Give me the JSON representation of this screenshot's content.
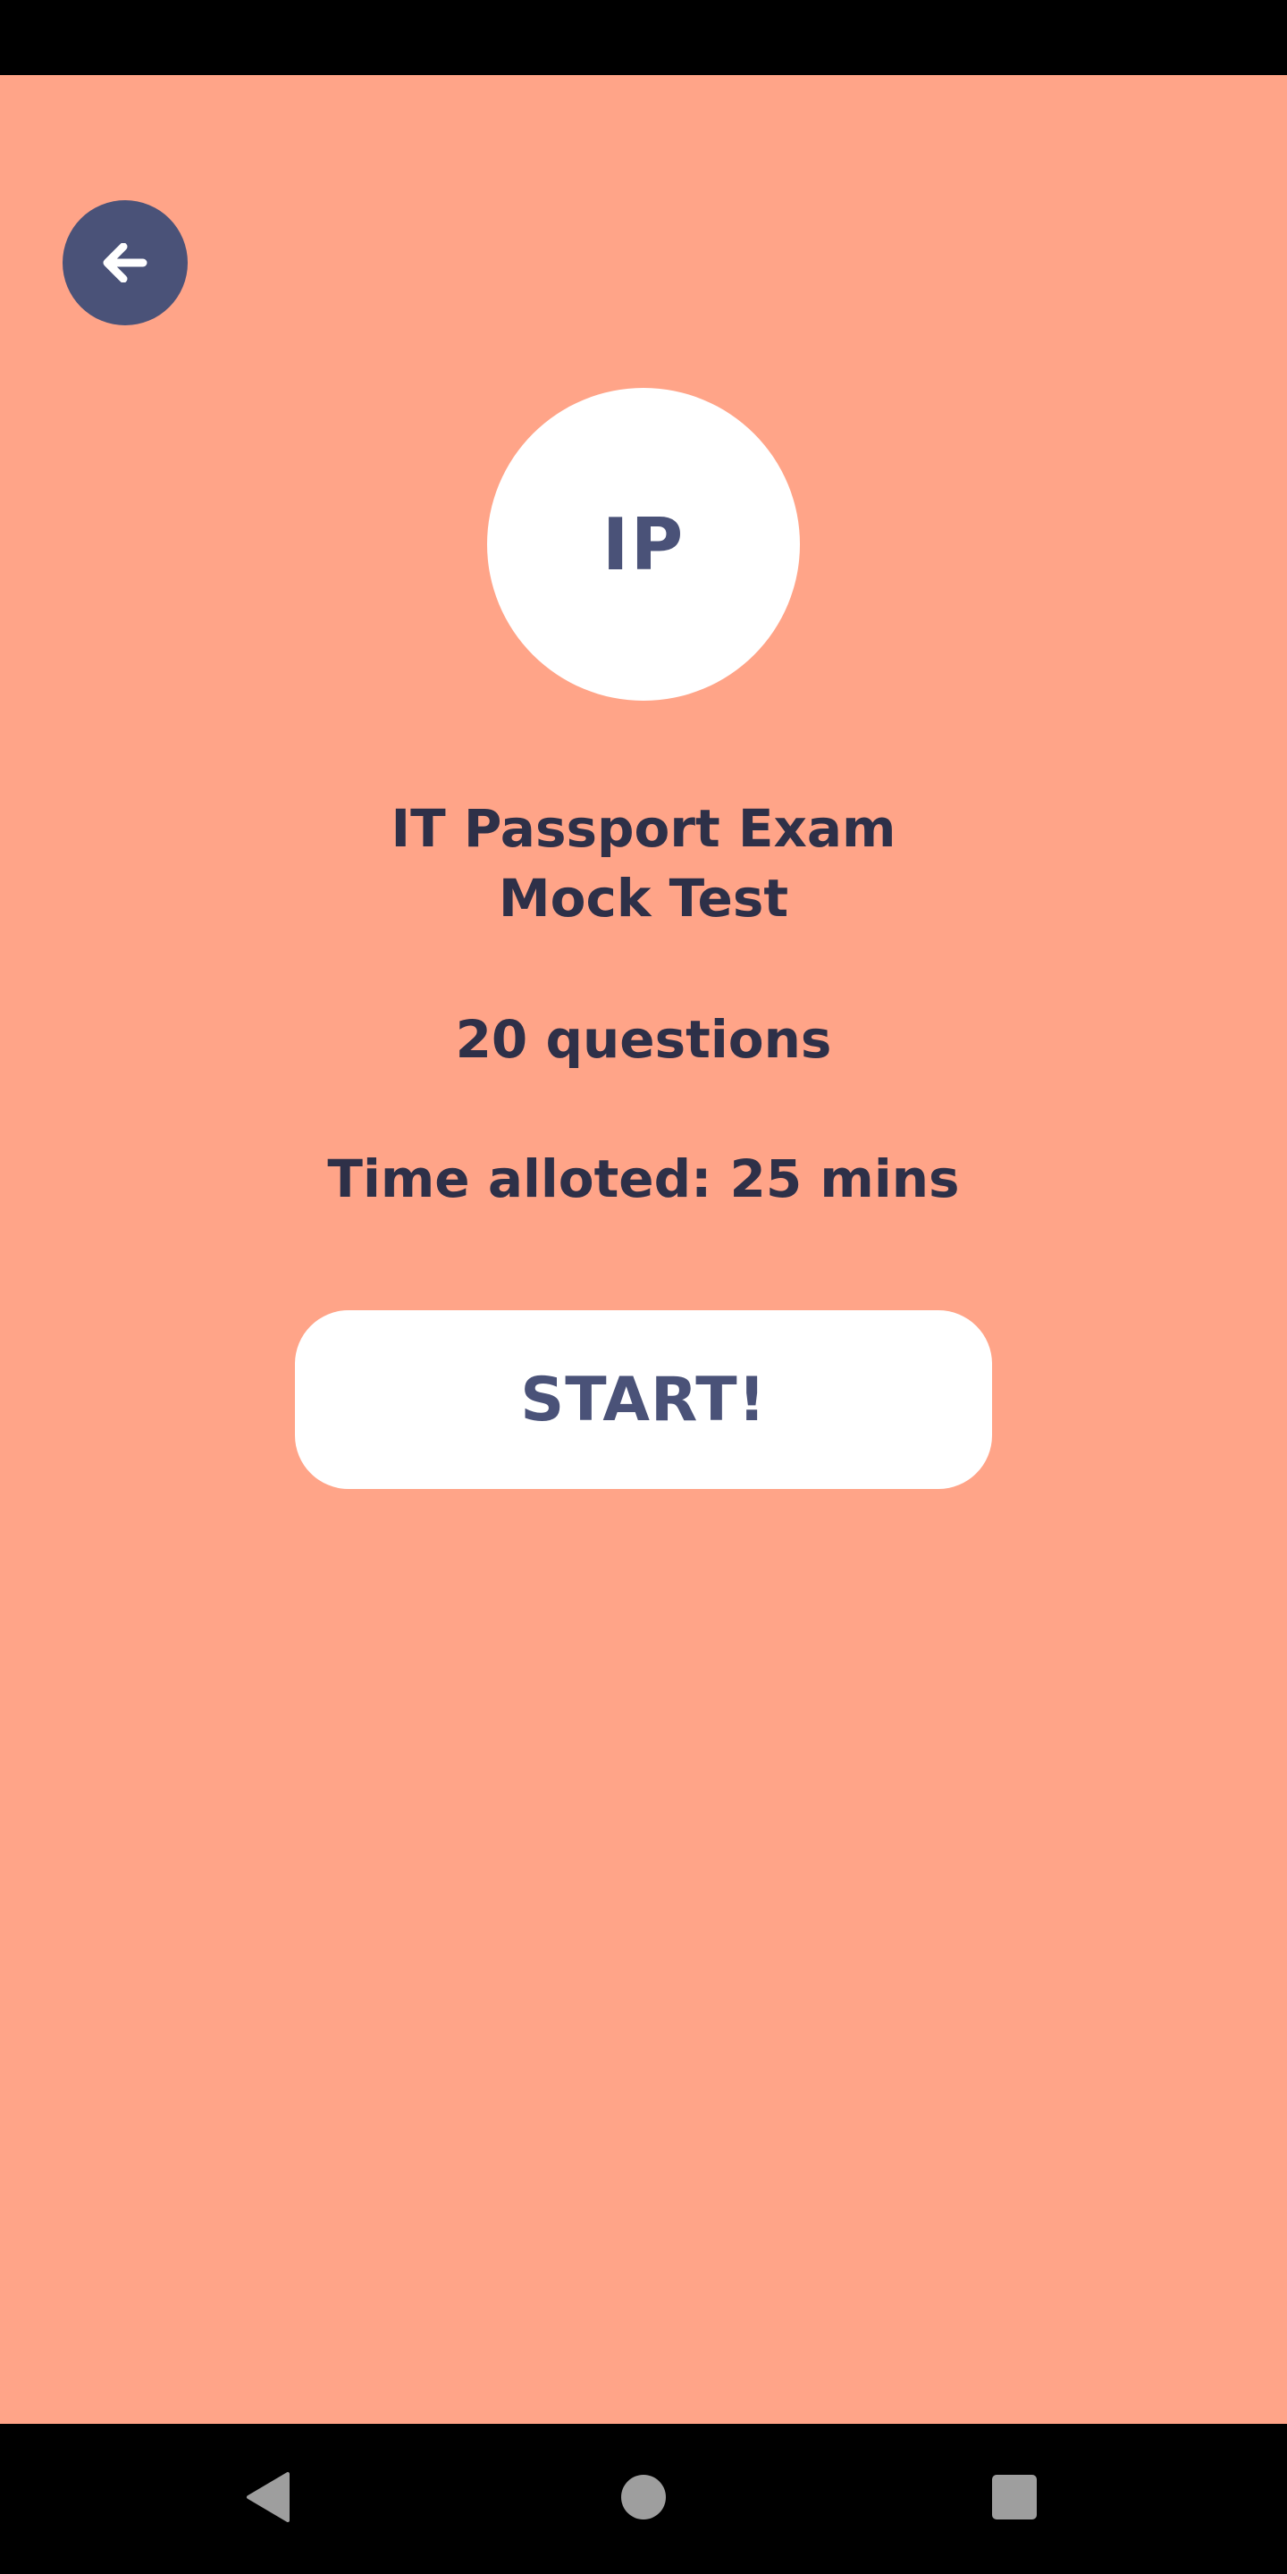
{
  "colors": {
    "background": "#FFA488",
    "accent": "#4A5278",
    "text": "#2E3048",
    "card": "#FFFFFF",
    "system_bars": "#000000",
    "nav_icons": "#9E9E9E"
  },
  "header": {
    "back_icon": "arrow-left-icon"
  },
  "exam": {
    "badge": "IP",
    "title_line1": "IT Passport Exam",
    "title_line2": "Mock Test",
    "questions": "20 questions",
    "time": "Time alloted: 25 mins"
  },
  "actions": {
    "start_label": "START!"
  },
  "navigation": {
    "back_icon": "triangle-back-icon",
    "home_icon": "circle-home-icon",
    "recents_icon": "square-recents-icon"
  }
}
